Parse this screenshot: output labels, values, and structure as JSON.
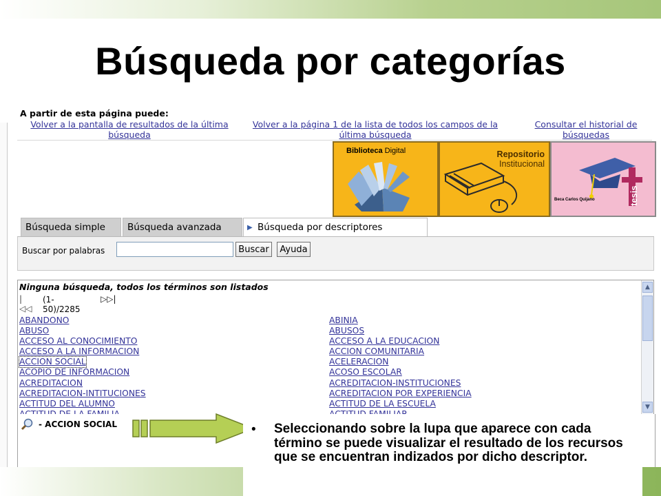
{
  "slide": {
    "title": "Búsqueda por categorías",
    "bullet": "Seleccionando sobre la lupa que aparece con cada término se puede visualizar el resultado de los recursos que se encuentran indizados por dicho descriptor."
  },
  "nav": {
    "heading": "A partir de esta página puede:",
    "links": [
      "Volver a la pantalla de resultados de la última búsqueda",
      "Volver a la página 1 de la lista de todos los campos de la última búsqueda",
      "Consultar el historial de búsquedas"
    ]
  },
  "banners": {
    "biblioteca": "Biblioteca",
    "digital": "Digital",
    "repositorio": "Repositorio",
    "institucional": "Institucional",
    "tesis": "tesis",
    "beca": "Beca Carlos Quijano"
  },
  "tabs": [
    "Búsqueda simple",
    "Búsqueda avanzada",
    "Búsqueda por descriptores"
  ],
  "search": {
    "label": "Buscar por palabras",
    "value": "",
    "buscar": "Buscar",
    "ayuda": "Ayuda"
  },
  "results": {
    "heading": "Ninguna búsqueda, todos los términos son listados",
    "range": "(1-50)/2285",
    "col1": [
      "ABANDONO",
      "ABUSO",
      "ACCESO AL CONOCIMIENTO",
      "ACCESO A LA INFORMACION",
      "ACCION SOCIAL",
      "ACOPIO DE INFORMACION",
      "ACREDITACION",
      "ACREDITACION-INTITUCIONES",
      "ACTITUD DEL ALUMNO",
      "ACTITUD DE LA FAMILIA"
    ],
    "col2": [
      "ABINIA",
      "ABUSOS",
      "ACCESO A LA EDUCACION",
      "ACCION COMUNITARIA",
      "ACELERACION",
      "ACOSO ESCOLAR",
      "ACREDITACION-INSTITUCIONES",
      "ACREDITACION POR EXPERIENCIA",
      "ACTITUD DE LA ESCUELA",
      "ACTITUD FAMILIAR"
    ]
  },
  "detail": {
    "term": "- ACCION SOCIAL"
  },
  "colors": {
    "accent_green": "#a6c67a",
    "arrow_fill": "#b5cf55",
    "link": "#333399",
    "banner_orange": "#f7b519"
  }
}
